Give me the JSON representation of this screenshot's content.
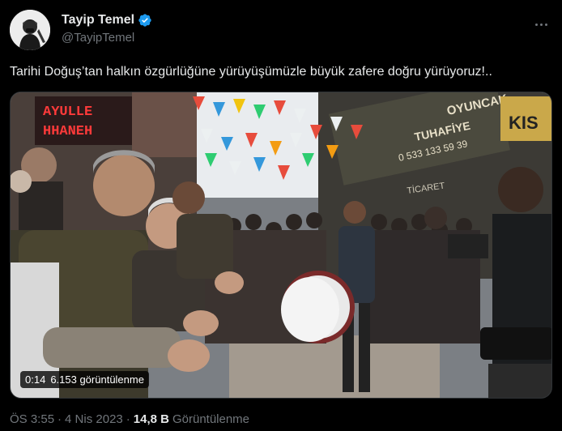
{
  "user": {
    "display_name": "Tayip Temel",
    "handle": "@TayipTemel",
    "verified": true,
    "avatar_icon": "portrait-avatar"
  },
  "tweet": {
    "text": "Tarihi Doğuş’tan halkın özgürlüğüne yürüyüşümüzle büyük zafere doğru yürüyoruz!.."
  },
  "video": {
    "duration": "0:14",
    "views_label": "6.153 görüntülenme",
    "signs": {
      "left_shop": "AYULLE\nHHANEH",
      "oyuncak": "OYUNCAK",
      "tuhafiye": "TUHAFİYE",
      "phone": "0 533 133 59 39",
      "right_top": "KIS",
      "ticaret": "TİCARET"
    }
  },
  "meta": {
    "time": "ÖS 3:55",
    "separator": "·",
    "date": "4 Nis 2023",
    "views_count": "14,8 B",
    "views_label": "Görüntülenme"
  },
  "colors": {
    "background": "#000000",
    "primary_text": "#e7e9ea",
    "secondary_text": "#71767b",
    "verified_blue": "#1d9bf0"
  }
}
